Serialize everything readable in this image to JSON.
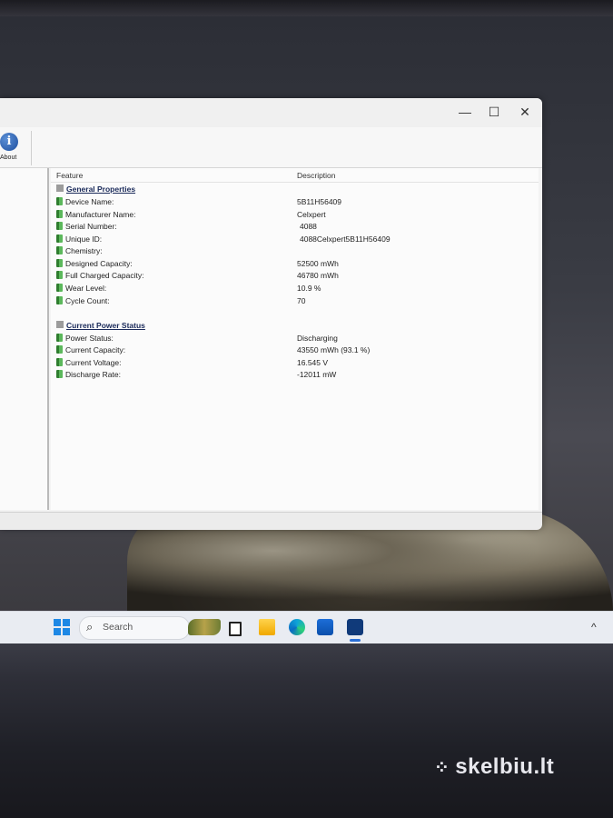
{
  "window": {
    "controls": {
      "minimize": "—",
      "maximize": "☐",
      "close": "✕"
    },
    "toolbar": {
      "about_label": "About",
      "about_glyph": "i"
    }
  },
  "table": {
    "columns": {
      "feature": "Feature",
      "description": "Description"
    },
    "sections": [
      {
        "title": "General Properties",
        "rows": [
          {
            "label": "Device Name:",
            "value": "5B11H56409"
          },
          {
            "label": "Manufacturer Name:",
            "value": "Celxpert"
          },
          {
            "label": "Serial Number:",
            "value": "4088"
          },
          {
            "label": "Unique ID:",
            "value": "4088Celxpert5B11H56409"
          },
          {
            "label": "Chemistry:",
            "value": ""
          },
          {
            "label": "Designed Capacity:",
            "value": "52500 mWh"
          },
          {
            "label": "Full Charged Capacity:",
            "value": "46780 mWh"
          },
          {
            "label": "Wear Level:",
            "value": "10.9 %"
          },
          {
            "label": "Cycle Count:",
            "value": "70"
          }
        ]
      },
      {
        "title": "Current Power Status",
        "rows": [
          {
            "label": "Power Status:",
            "value": "Discharging"
          },
          {
            "label": "Current Capacity:",
            "value": "43550 mWh (93.1 %)"
          },
          {
            "label": "Current Voltage:",
            "value": "16.545 V"
          },
          {
            "label": "Discharge Rate:",
            "value": "-12011 mW"
          }
        ]
      }
    ]
  },
  "taskbar": {
    "search_placeholder": "Search",
    "search_glyph": "⌕",
    "chevron": "^",
    "accent": "#1e88e5"
  },
  "watermark": {
    "dots": "⁘",
    "text": "skelbiu.lt"
  }
}
